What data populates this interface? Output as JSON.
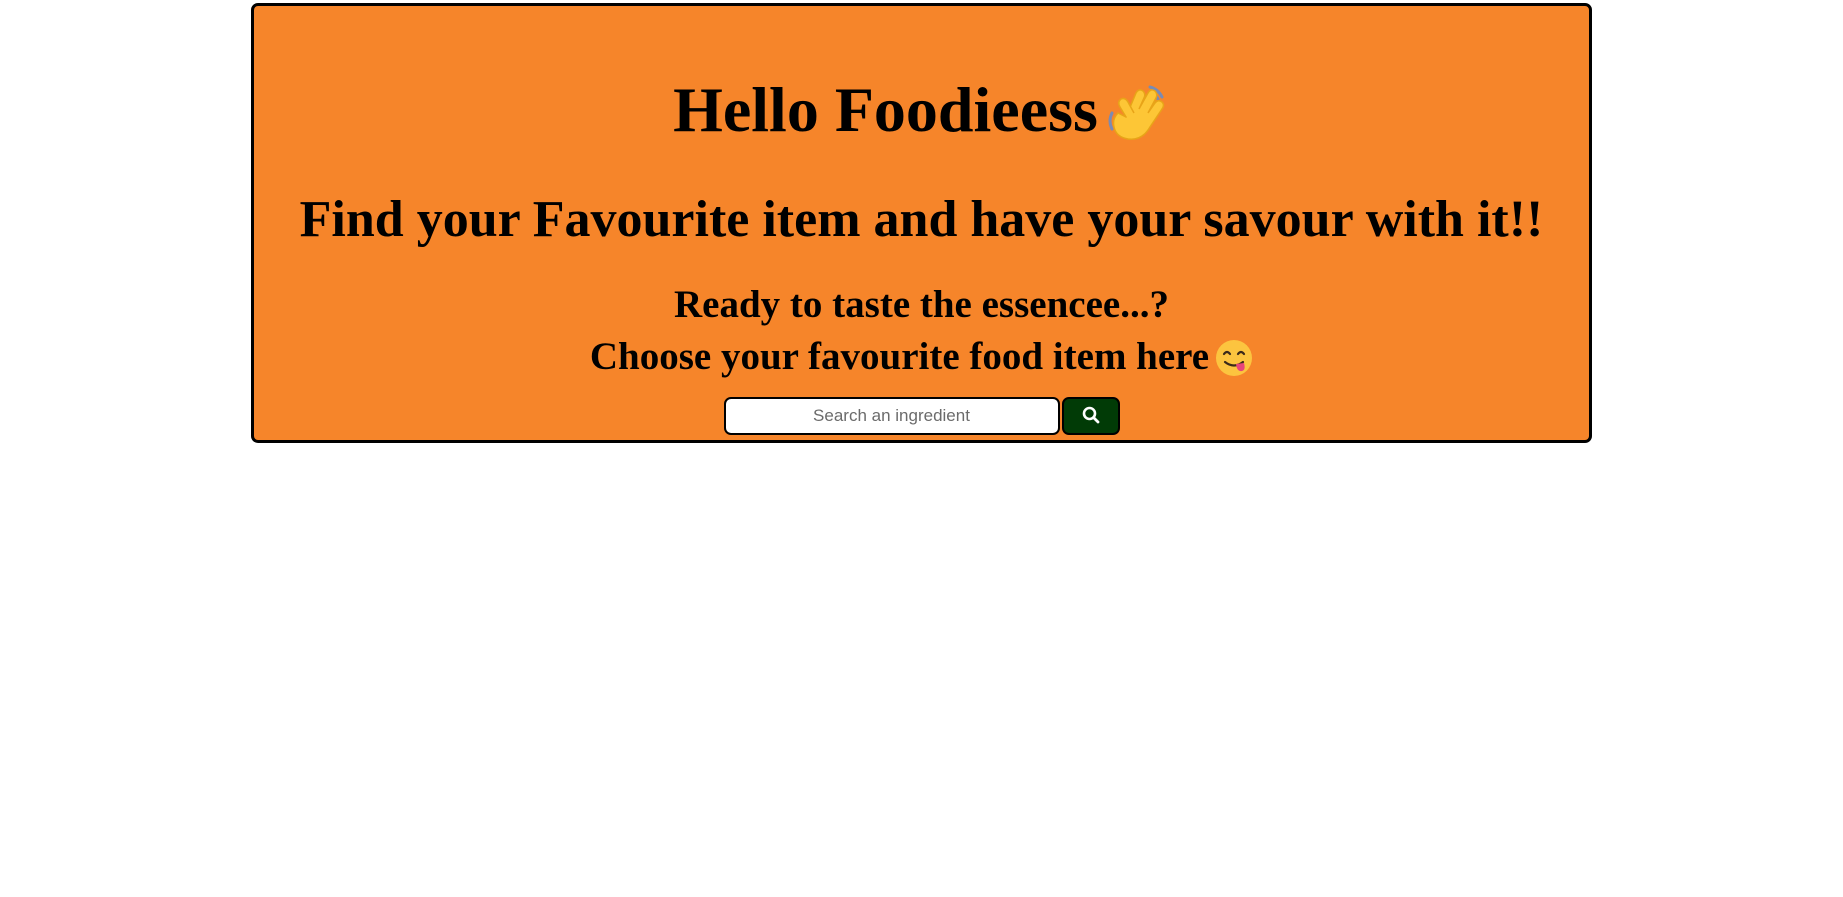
{
  "hero": {
    "title": "Hello Foodieess",
    "title_emoji": "waving-hand-emoji",
    "subtitle": "Find your Favourite item and have your savour with it!!",
    "tagline_line1": "Ready to taste the essencee...?",
    "tagline_line2": "Choose your favourite food item here",
    "tagline_emoji": "face-savoring-food-emoji"
  },
  "search": {
    "placeholder": "Search an ingredient",
    "value": "",
    "button_icon": "search-icon"
  },
  "colors": {
    "page_background": "#ffffff",
    "hero_background": "#f6852a",
    "hero_border": "#000000",
    "search_button_background": "#013b06",
    "search_icon": "#ffffff"
  }
}
